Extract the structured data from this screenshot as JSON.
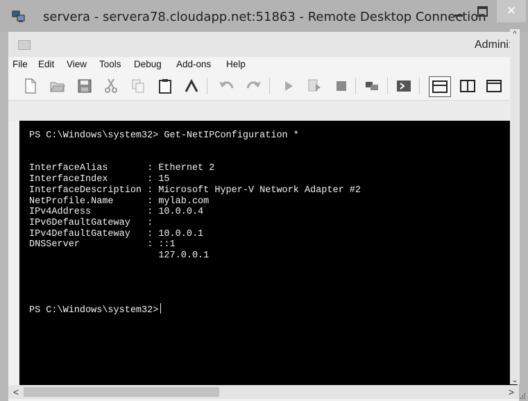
{
  "window": {
    "title": "servera - servera78.cloudapp.net:51863 - Remote Desktop Connection",
    "minimize_label": "",
    "close_label": "✕"
  },
  "ise": {
    "title": "Admini:",
    "menu": [
      "File",
      "Edit",
      "View",
      "Tools",
      "Debug",
      "Add-ons",
      "Help"
    ]
  },
  "toolbar": {
    "icons": [
      "new-file-icon",
      "open-icon",
      "save-icon",
      "cut-icon",
      "copy-icon",
      "paste-icon",
      "clear-icon",
      "undo-icon",
      "redo-icon",
      "run-icon",
      "run-selection-icon",
      "stop-icon",
      "remote-powershell-icon",
      "powershell-console-icon",
      "script-pane-top-icon",
      "script-pane-right-icon",
      "script-pane-maximized-icon"
    ]
  },
  "console": {
    "prompt_command": "PS C:\\Windows\\system32> Get-NetIPConfiguration *",
    "output": [
      "InterfaceAlias       : Ethernet 2",
      "InterfaceIndex       : 15",
      "InterfaceDescription : Microsoft Hyper-V Network Adapter #2",
      "NetProfile.Name      : mylab.com",
      "IPv4Address          : 10.0.0.4",
      "IPv6DefaultGateway   :",
      "IPv4DefaultGateway   : 10.0.0.1",
      "DNSServer            : ::1",
      "                       127.0.0.1"
    ],
    "prompt": "PS C:\\Windows\\system32>"
  },
  "scrollbar": {
    "up": "^",
    "down": "⌄",
    "left": "<",
    "right": ">"
  }
}
